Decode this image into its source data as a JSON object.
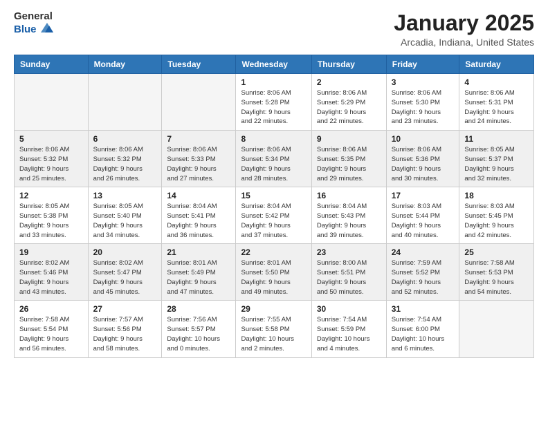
{
  "header": {
    "logo_general": "General",
    "logo_blue": "Blue",
    "title": "January 2025",
    "subtitle": "Arcadia, Indiana, United States"
  },
  "days_of_week": [
    "Sunday",
    "Monday",
    "Tuesday",
    "Wednesday",
    "Thursday",
    "Friday",
    "Saturday"
  ],
  "weeks": [
    [
      {
        "day": "",
        "info": ""
      },
      {
        "day": "",
        "info": ""
      },
      {
        "day": "",
        "info": ""
      },
      {
        "day": "1",
        "info": "Sunrise: 8:06 AM\nSunset: 5:28 PM\nDaylight: 9 hours\nand 22 minutes."
      },
      {
        "day": "2",
        "info": "Sunrise: 8:06 AM\nSunset: 5:29 PM\nDaylight: 9 hours\nand 22 minutes."
      },
      {
        "day": "3",
        "info": "Sunrise: 8:06 AM\nSunset: 5:30 PM\nDaylight: 9 hours\nand 23 minutes."
      },
      {
        "day": "4",
        "info": "Sunrise: 8:06 AM\nSunset: 5:31 PM\nDaylight: 9 hours\nand 24 minutes."
      }
    ],
    [
      {
        "day": "5",
        "info": "Sunrise: 8:06 AM\nSunset: 5:32 PM\nDaylight: 9 hours\nand 25 minutes."
      },
      {
        "day": "6",
        "info": "Sunrise: 8:06 AM\nSunset: 5:32 PM\nDaylight: 9 hours\nand 26 minutes."
      },
      {
        "day": "7",
        "info": "Sunrise: 8:06 AM\nSunset: 5:33 PM\nDaylight: 9 hours\nand 27 minutes."
      },
      {
        "day": "8",
        "info": "Sunrise: 8:06 AM\nSunset: 5:34 PM\nDaylight: 9 hours\nand 28 minutes."
      },
      {
        "day": "9",
        "info": "Sunrise: 8:06 AM\nSunset: 5:35 PM\nDaylight: 9 hours\nand 29 minutes."
      },
      {
        "day": "10",
        "info": "Sunrise: 8:06 AM\nSunset: 5:36 PM\nDaylight: 9 hours\nand 30 minutes."
      },
      {
        "day": "11",
        "info": "Sunrise: 8:05 AM\nSunset: 5:37 PM\nDaylight: 9 hours\nand 32 minutes."
      }
    ],
    [
      {
        "day": "12",
        "info": "Sunrise: 8:05 AM\nSunset: 5:38 PM\nDaylight: 9 hours\nand 33 minutes."
      },
      {
        "day": "13",
        "info": "Sunrise: 8:05 AM\nSunset: 5:40 PM\nDaylight: 9 hours\nand 34 minutes."
      },
      {
        "day": "14",
        "info": "Sunrise: 8:04 AM\nSunset: 5:41 PM\nDaylight: 9 hours\nand 36 minutes."
      },
      {
        "day": "15",
        "info": "Sunrise: 8:04 AM\nSunset: 5:42 PM\nDaylight: 9 hours\nand 37 minutes."
      },
      {
        "day": "16",
        "info": "Sunrise: 8:04 AM\nSunset: 5:43 PM\nDaylight: 9 hours\nand 39 minutes."
      },
      {
        "day": "17",
        "info": "Sunrise: 8:03 AM\nSunset: 5:44 PM\nDaylight: 9 hours\nand 40 minutes."
      },
      {
        "day": "18",
        "info": "Sunrise: 8:03 AM\nSunset: 5:45 PM\nDaylight: 9 hours\nand 42 minutes."
      }
    ],
    [
      {
        "day": "19",
        "info": "Sunrise: 8:02 AM\nSunset: 5:46 PM\nDaylight: 9 hours\nand 43 minutes."
      },
      {
        "day": "20",
        "info": "Sunrise: 8:02 AM\nSunset: 5:47 PM\nDaylight: 9 hours\nand 45 minutes."
      },
      {
        "day": "21",
        "info": "Sunrise: 8:01 AM\nSunset: 5:49 PM\nDaylight: 9 hours\nand 47 minutes."
      },
      {
        "day": "22",
        "info": "Sunrise: 8:01 AM\nSunset: 5:50 PM\nDaylight: 9 hours\nand 49 minutes."
      },
      {
        "day": "23",
        "info": "Sunrise: 8:00 AM\nSunset: 5:51 PM\nDaylight: 9 hours\nand 50 minutes."
      },
      {
        "day": "24",
        "info": "Sunrise: 7:59 AM\nSunset: 5:52 PM\nDaylight: 9 hours\nand 52 minutes."
      },
      {
        "day": "25",
        "info": "Sunrise: 7:58 AM\nSunset: 5:53 PM\nDaylight: 9 hours\nand 54 minutes."
      }
    ],
    [
      {
        "day": "26",
        "info": "Sunrise: 7:58 AM\nSunset: 5:54 PM\nDaylight: 9 hours\nand 56 minutes."
      },
      {
        "day": "27",
        "info": "Sunrise: 7:57 AM\nSunset: 5:56 PM\nDaylight: 9 hours\nand 58 minutes."
      },
      {
        "day": "28",
        "info": "Sunrise: 7:56 AM\nSunset: 5:57 PM\nDaylight: 10 hours\nand 0 minutes."
      },
      {
        "day": "29",
        "info": "Sunrise: 7:55 AM\nSunset: 5:58 PM\nDaylight: 10 hours\nand 2 minutes."
      },
      {
        "day": "30",
        "info": "Sunrise: 7:54 AM\nSunset: 5:59 PM\nDaylight: 10 hours\nand 4 minutes."
      },
      {
        "day": "31",
        "info": "Sunrise: 7:54 AM\nSunset: 6:00 PM\nDaylight: 10 hours\nand 6 minutes."
      },
      {
        "day": "",
        "info": ""
      }
    ]
  ]
}
